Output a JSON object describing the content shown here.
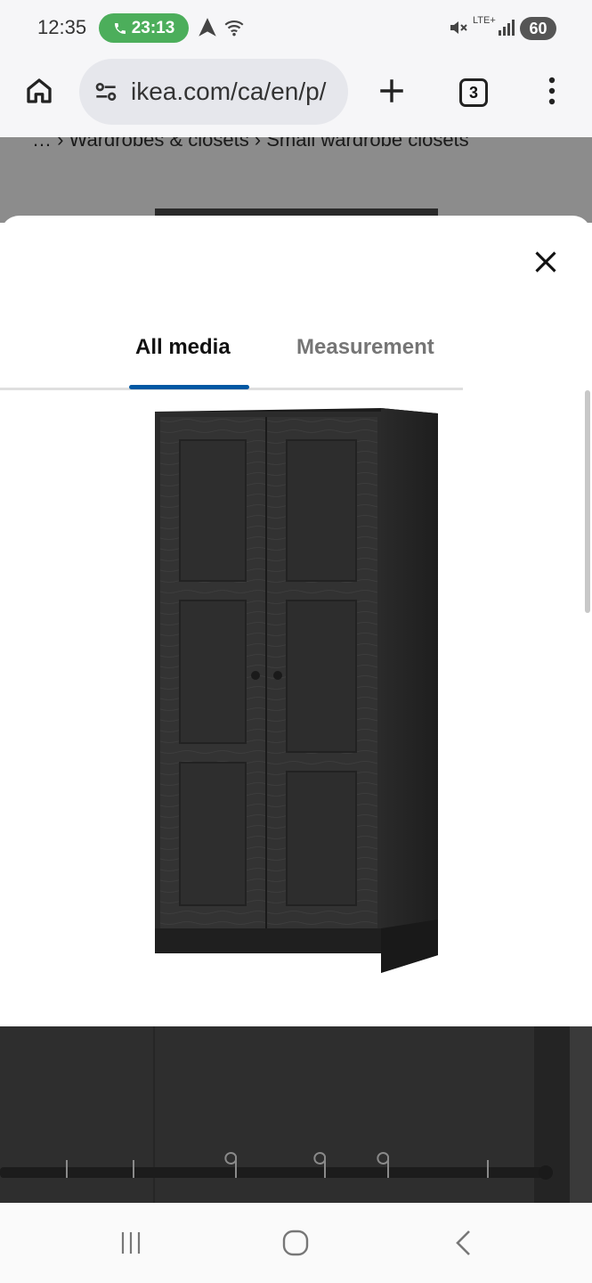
{
  "status_bar": {
    "time": "12:35",
    "call_timer": "23:13",
    "battery": "60",
    "network": "LTE+"
  },
  "browser": {
    "url": "ikea.com/ca/en/p/",
    "tab_count": "3"
  },
  "background_page": {
    "breadcrumb": "…  ›  Wardrobes & closets  ›  Small wardrobe closets"
  },
  "modal": {
    "tabs": [
      {
        "label": "All media",
        "active": true
      },
      {
        "label": "Measurement",
        "active": false
      }
    ],
    "accent_color": "#0058a3"
  },
  "icons": {
    "home": "home-icon",
    "site_settings": "tune-icon",
    "new_tab": "plus-icon",
    "menu": "more-vert-icon",
    "close": "close-icon",
    "recents": "recents-icon",
    "home_nav": "home-nav-icon",
    "back": "back-icon"
  }
}
